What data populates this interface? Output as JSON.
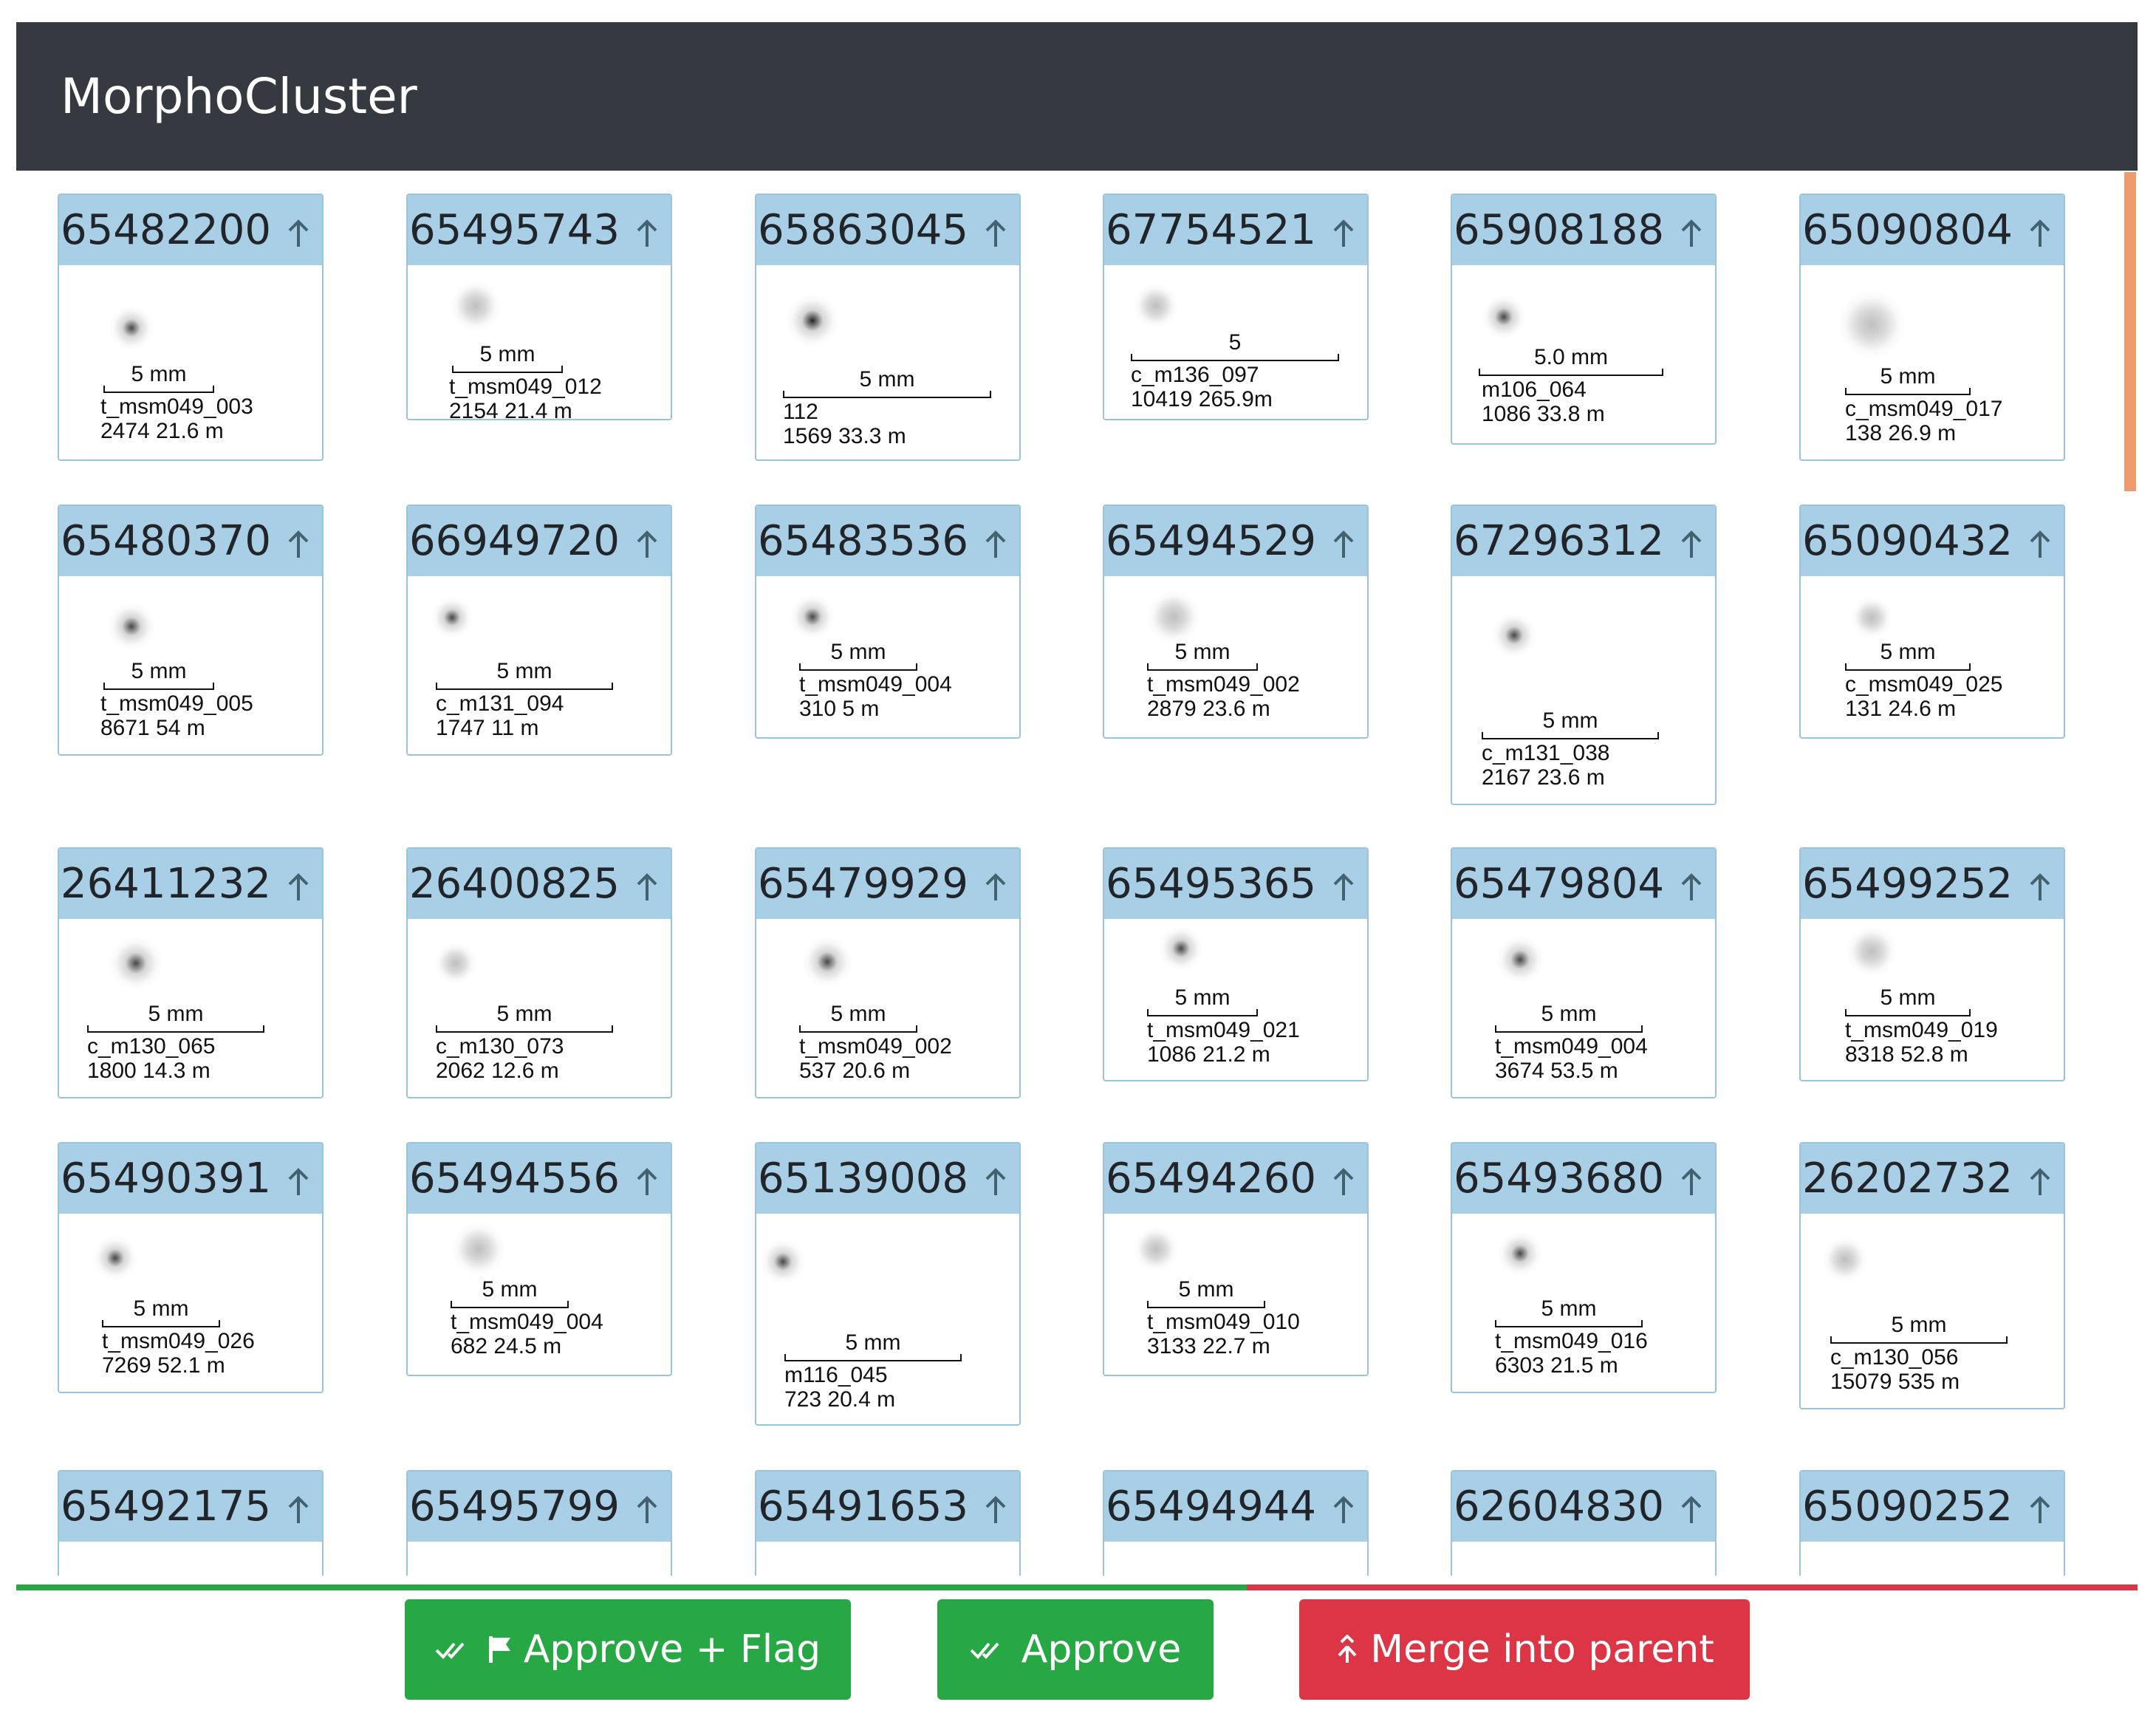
{
  "app": {
    "title": "MorphoCluster"
  },
  "colors": {
    "header_bg": "#343a40",
    "card_header_bg": "#a9cfe7",
    "card_border": "#9cc3dc",
    "approve_green": "#28a745",
    "merge_red": "#dc3545",
    "scrollbar_thumb": "#ee9a6e"
  },
  "progress": {
    "approved_fraction": 0.58
  },
  "cards": [
    {
      "id": "65482200",
      "scale": "5 mm",
      "lines": [
        "t_msm049_003",
        "2474   21.6 m"
      ]
    },
    {
      "id": "65495743",
      "scale": "5 mm",
      "lines": [
        "t_msm049_012",
        "2154   21.4 m"
      ]
    },
    {
      "id": "65863045",
      "scale": "5 mm",
      "lines": [
        "112",
        "1569   33.3 m"
      ]
    },
    {
      "id": "67754521",
      "scale": "5",
      "lines": [
        "c_m136_097",
        "10419 265.9m"
      ]
    },
    {
      "id": "65908188",
      "scale": "5.0 mm",
      "lines": [
        "m106_064",
        "1086   33.8 m"
      ]
    },
    {
      "id": "65090804",
      "scale": "5 mm",
      "lines": [
        "c_msm049_017",
        "138   26.9 m"
      ]
    },
    {
      "id": "65480370",
      "scale": "5 mm",
      "lines": [
        "t_msm049_005",
        "8671   54 m"
      ]
    },
    {
      "id": "66949720",
      "scale": "5 mm",
      "lines": [
        "c_m131_094",
        "1747   11 m"
      ]
    },
    {
      "id": "65483536",
      "scale": "5 mm",
      "lines": [
        "t_msm049_004",
        "310   5 m"
      ]
    },
    {
      "id": "65494529",
      "scale": "5 mm",
      "lines": [
        "t_msm049_002",
        "2879   23.6 m"
      ]
    },
    {
      "id": "67296312",
      "scale": "5 mm",
      "lines": [
        "c_m131_038",
        "2167   23.6 m"
      ]
    },
    {
      "id": "65090432",
      "scale": "5 mm",
      "lines": [
        "c_msm049_025",
        "131   24.6 m"
      ]
    },
    {
      "id": "26411232",
      "scale": "5 mm",
      "lines": [
        "c_m130_065",
        "1800   14.3 m"
      ]
    },
    {
      "id": "26400825",
      "scale": "5 mm",
      "lines": [
        "c_m130_073",
        "2062   12.6 m"
      ]
    },
    {
      "id": "65479929",
      "scale": "5 mm",
      "lines": [
        "t_msm049_002",
        "537   20.6 m"
      ]
    },
    {
      "id": "65495365",
      "scale": "5 mm",
      "lines": [
        "t_msm049_021",
        "1086   21.2 m"
      ]
    },
    {
      "id": "65479804",
      "scale": "5 mm",
      "lines": [
        "t_msm049_004",
        "3674   53.5 m"
      ]
    },
    {
      "id": "65499252",
      "scale": "5 mm",
      "lines": [
        "t_msm049_019",
        "8318   52.8 m"
      ]
    },
    {
      "id": "65490391",
      "scale": "5 mm",
      "lines": [
        "t_msm049_026",
        "7269   52.1 m"
      ]
    },
    {
      "id": "65494556",
      "scale": "5 mm",
      "lines": [
        "t_msm049_004",
        "682   24.5 m"
      ]
    },
    {
      "id": "65139008",
      "scale": "5 mm",
      "lines": [
        "m116_045",
        "723   20.4 m"
      ]
    },
    {
      "id": "65494260",
      "scale": "5 mm",
      "lines": [
        "t_msm049_010",
        "3133   22.7 m"
      ]
    },
    {
      "id": "65493680",
      "scale": "5 mm",
      "lines": [
        "t_msm049_016",
        "6303   21.5 m"
      ]
    },
    {
      "id": "26202732",
      "scale": "5 mm",
      "lines": [
        "c_m130_056",
        "15079   535 m"
      ]
    },
    {
      "id": "65492175",
      "scale": "",
      "lines": []
    },
    {
      "id": "65495799",
      "scale": "",
      "lines": []
    },
    {
      "id": "65491653",
      "scale": "",
      "lines": []
    },
    {
      "id": "65494944",
      "scale": "",
      "lines": []
    },
    {
      "id": "62604830",
      "scale": "",
      "lines": []
    },
    {
      "id": "65090252",
      "scale": "",
      "lines": []
    }
  ],
  "actions": {
    "approve_flag_label": "Approve + Flag",
    "approve_label": "Approve",
    "merge_label": "Merge into parent"
  }
}
